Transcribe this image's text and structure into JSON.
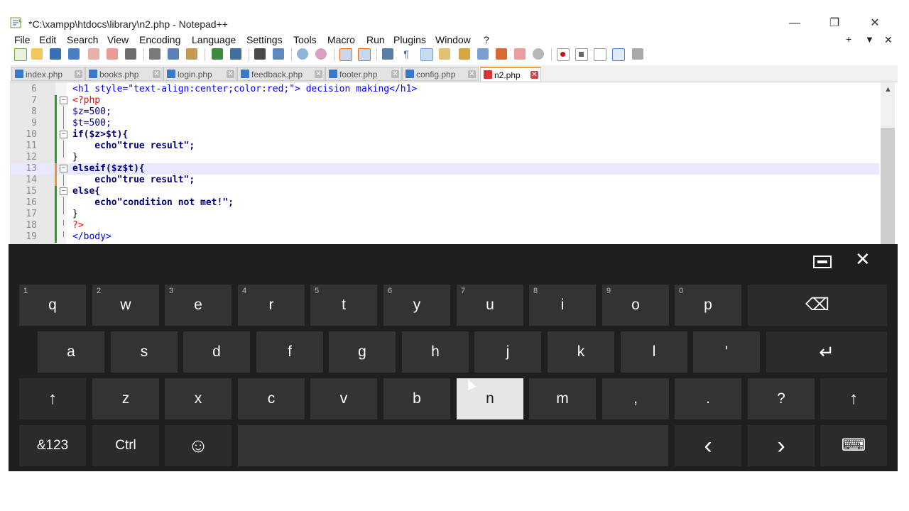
{
  "window": {
    "title": "*C:\\xampp\\htdocs\\library\\n2.php - Notepad++"
  },
  "window_controls": {
    "minimize": "—",
    "restore": "❐",
    "close": "✕"
  },
  "menu": [
    "File",
    "Edit",
    "Search",
    "View",
    "Encoding",
    "Language",
    "Settings",
    "Tools",
    "Macro",
    "Run",
    "Plugins",
    "Window",
    "?"
  ],
  "menu_right": {
    "plus": "+",
    "down": "▼",
    "close": "✕"
  },
  "tabs": [
    {
      "label": "index.php"
    },
    {
      "label": "books.php"
    },
    {
      "label": "login.php"
    },
    {
      "label": "feedback.php"
    },
    {
      "label": "footer.php"
    },
    {
      "label": "config.php"
    },
    {
      "label": "n2.php",
      "active": true
    }
  ],
  "tab_close_glyph": "✕",
  "editor": {
    "lines": [
      {
        "no": "6",
        "text": "<h1 style=\"text-align:center;color:red;\"> decision making</h1>"
      },
      {
        "no": "7",
        "text": "<?php"
      },
      {
        "no": "8",
        "text": "$z=500;"
      },
      {
        "no": "9",
        "text": "$t=500;"
      },
      {
        "no": "10",
        "text": "if($z>$t){"
      },
      {
        "no": "11",
        "text": "    echo\"true result\";"
      },
      {
        "no": "12",
        "text": "}"
      },
      {
        "no": "13",
        "text": "elseif($z$t){"
      },
      {
        "no": "14",
        "text": "    echo\"true result\";"
      },
      {
        "no": "15",
        "text": "else{"
      },
      {
        "no": "16",
        "text": "    echo\"condition not met!\";"
      },
      {
        "no": "17",
        "text": "}"
      },
      {
        "no": "18",
        "text": "?>"
      },
      {
        "no": "19",
        "text": "</body>"
      }
    ]
  },
  "keyboard": {
    "top_icons": {
      "dock": "dock-icon",
      "close": "✕"
    },
    "row1": [
      {
        "hint": "1",
        "label": "q"
      },
      {
        "hint": "2",
        "label": "w"
      },
      {
        "hint": "3",
        "label": "e"
      },
      {
        "hint": "4",
        "label": "r"
      },
      {
        "hint": "5",
        "label": "t"
      },
      {
        "hint": "6",
        "label": "y"
      },
      {
        "hint": "7",
        "label": "u"
      },
      {
        "hint": "8",
        "label": "i"
      },
      {
        "hint": "9",
        "label": "o"
      },
      {
        "hint": "0",
        "label": "p"
      }
    ],
    "backspace": "⌫",
    "row2": [
      "a",
      "s",
      "d",
      "f",
      "g",
      "h",
      "j",
      "k",
      "l",
      "'"
    ],
    "enter": "↵",
    "shift": "↑",
    "row3": [
      "z",
      "x",
      "c",
      "v",
      "b",
      "n",
      "m",
      ",",
      ".",
      "?"
    ],
    "pressed_key": "n",
    "row4": {
      "symbols": "&123",
      "ctrl": "Ctrl",
      "emoji": "☺",
      "left": "‹",
      "right": "›",
      "kb": "⌨"
    }
  }
}
